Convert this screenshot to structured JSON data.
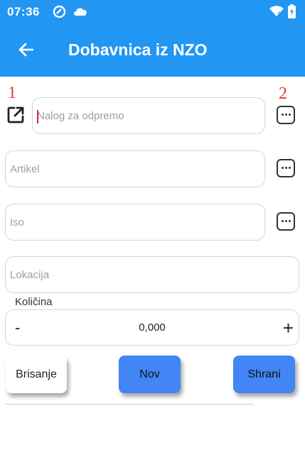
{
  "status_bar": {
    "time": "07:36"
  },
  "app_bar": {
    "title": "Dobavnica iz NZO"
  },
  "annotations": {
    "label_1": "1",
    "label_2": "2"
  },
  "form": {
    "nalog": {
      "placeholder": "Nalog za odpremo",
      "value": ""
    },
    "artikel": {
      "placeholder": "Artikel",
      "value": ""
    },
    "iso": {
      "placeholder": "Iso",
      "value": ""
    },
    "lokacija": {
      "placeholder": "Lokacija",
      "value": ""
    },
    "kolicina": {
      "label": "Količina",
      "value": "0,000",
      "minus_label": "-",
      "plus_label": "+"
    }
  },
  "buttons": {
    "brisanje": "Brisanje",
    "nov": "Nov",
    "shrani": "Shrani"
  },
  "colors": {
    "primary": "#2196f3",
    "button_blue": "#4285f4",
    "annotation_red": "#e53935",
    "caret": "#e91e63"
  },
  "icons": {
    "status_left": [
      "do-not-disturb-icon",
      "cloud-icon"
    ],
    "status_right": [
      "wifi-icon",
      "battery-charging-icon"
    ],
    "back": "arrow-left-icon",
    "open_external": "open-in-new-icon",
    "more": "more-horizontal-icon"
  }
}
